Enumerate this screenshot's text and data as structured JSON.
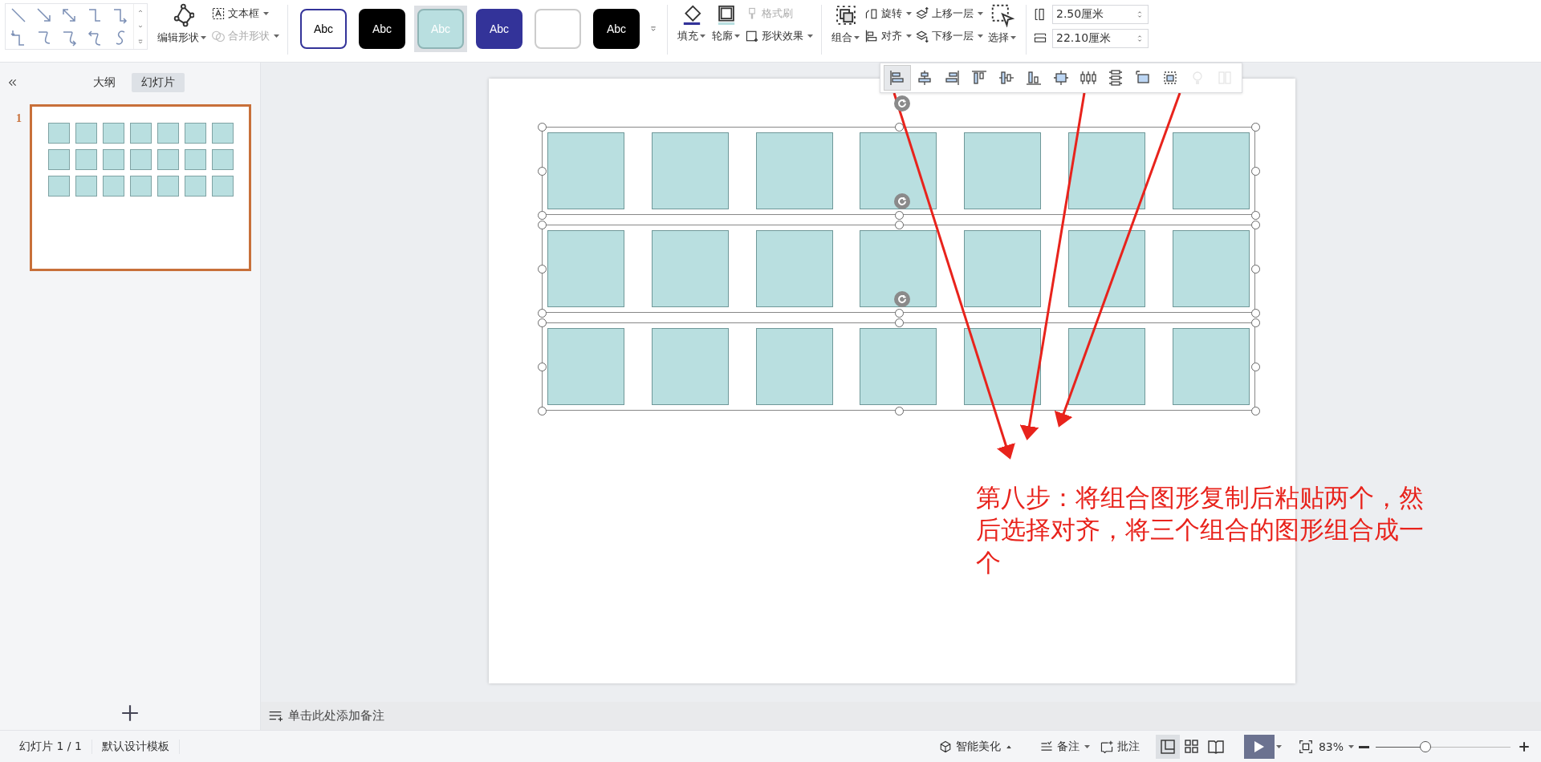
{
  "ribbon": {
    "edit_shape": "编辑形状",
    "text_box": "文本框",
    "merge_shapes": {
      "label": "合并形状",
      "disabled": true
    },
    "style_presets": [
      {
        "label": "Abc",
        "color": "#ffffff",
        "selected": false
      },
      {
        "label": "Abc",
        "color": "#000000",
        "selected": false
      },
      {
        "label": "Abc",
        "color": "#b9dfe0",
        "selected": true
      },
      {
        "label": "Abc",
        "color": "#333399",
        "selected": false
      },
      {
        "color": "#ffffff",
        "selected": false
      },
      {
        "label": "Abc",
        "color": "#000000",
        "selected": false
      }
    ],
    "fill": "填充",
    "outline": "轮廓",
    "format_painter": {
      "label": "格式刷",
      "disabled": true
    },
    "shape_effects": "形状效果",
    "group": "组合",
    "rotate": "旋转",
    "align": "对齐",
    "bring_forward": "上移一层",
    "send_backward": "下移一层",
    "select": "选择",
    "height_field": "2.50厘米",
    "width_field": "22.10厘米"
  },
  "left_panel": {
    "tabs": [
      {
        "label": "大纲",
        "selected": false
      },
      {
        "label": "幻灯片",
        "selected": true
      }
    ],
    "thumbnails": [
      {
        "number": "1",
        "selected": true
      }
    ]
  },
  "align_toolbar": [
    {
      "kind": "left",
      "selected": true,
      "disabled": false
    },
    {
      "kind": "hcenter",
      "selected": false,
      "disabled": false
    },
    {
      "kind": "right",
      "selected": false,
      "disabled": false
    },
    {
      "kind": "top",
      "selected": false,
      "disabled": false
    },
    {
      "kind": "vcenter",
      "selected": false,
      "disabled": false
    },
    {
      "kind": "bottom",
      "selected": false,
      "disabled": false
    },
    {
      "kind": "center",
      "selected": false,
      "disabled": false
    },
    {
      "kind": "hdist",
      "selected": false,
      "disabled": false
    },
    {
      "kind": "vdist",
      "selected": false,
      "disabled": false
    },
    {
      "kind": "page",
      "selected": false,
      "disabled": false
    },
    {
      "kind": "group",
      "selected": false,
      "disabled": false
    },
    {
      "kind": "bulb",
      "selected": false,
      "disabled": true
    },
    {
      "kind": "split",
      "selected": false,
      "disabled": true
    }
  ],
  "slide": {
    "groups": [
      {
        "selected": true
      },
      {
        "selected": true
      },
      {
        "selected": true
      }
    ],
    "annotation": "第八步：将组合图形复制后粘贴两个，然后选择对齐，将三个组合的图形组合成一个"
  },
  "notes": {
    "placeholder": "单击此处添加备注"
  },
  "status_bar": {
    "slide_counter": "幻灯片 1 / 1",
    "template": "默认设计模板",
    "beautify": "智能美化",
    "notes": "备注",
    "comments": "批注",
    "views": [
      {
        "kind": "normal",
        "selected": true
      },
      {
        "kind": "sorter",
        "selected": false
      },
      {
        "kind": "reading",
        "selected": false
      }
    ],
    "zoom": "83%",
    "zoom_slider": {
      "level": 0.37
    }
  }
}
